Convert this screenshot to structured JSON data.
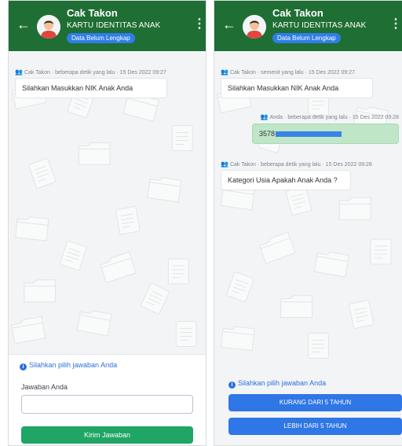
{
  "left": {
    "header": {
      "title": "Cak Takon",
      "subtitle": "KARTU IDENTITAS ANAK",
      "badge": "Data Belum Lengkap"
    },
    "messages": [
      {
        "sender": "Cak Takon",
        "time": "beberapa detik yang lalu",
        "date": "15 Des 2022 09:27",
        "text": "Silahkan Masukkan NIK Anak Anda"
      }
    ],
    "answer": {
      "hint": "Silahkan pilih jawaban Anda",
      "field_label": "Jawaban Anda",
      "field_value": "",
      "submit_label": "Kirim Jawaban"
    }
  },
  "right": {
    "header": {
      "title": "Cak Takon",
      "subtitle": "KARTU IDENTITAS ANAK",
      "badge": "Data Belum Lengkap"
    },
    "messages": [
      {
        "sender": "Cak Takon",
        "time": "semenit yang lalu",
        "date": "15 Des 2022 09:27",
        "text": "Silahkan Masukkan NIK Anak Anda"
      },
      {
        "sender": "Anda",
        "time": "beberapa detik yang lalu",
        "date": "15 Des 2022 09:28",
        "text": "3578"
      },
      {
        "sender": "Cak Takon",
        "time": "beberapa detik yang lalu",
        "date": "15 Des 2022 09:28",
        "text": "Kategori Usia Apakah Anak Anda ?"
      }
    ],
    "answer": {
      "hint": "Silahkan pilih jawaban Anda",
      "options": [
        "KURANG DARI 5 TAHUN",
        "LEBIH DARI 5 TAHUN"
      ]
    }
  },
  "icons": {
    "back": "arrow-left-icon",
    "menu": "kebab-menu-icon",
    "user": "user-group-icon",
    "info": "info-icon"
  },
  "colors": {
    "header": "#1f6e34",
    "badge": "#2f7ee8",
    "user_bubble": "#bfe6c7",
    "primary_button": "#1fa564",
    "option_button": "#2f76e6"
  }
}
